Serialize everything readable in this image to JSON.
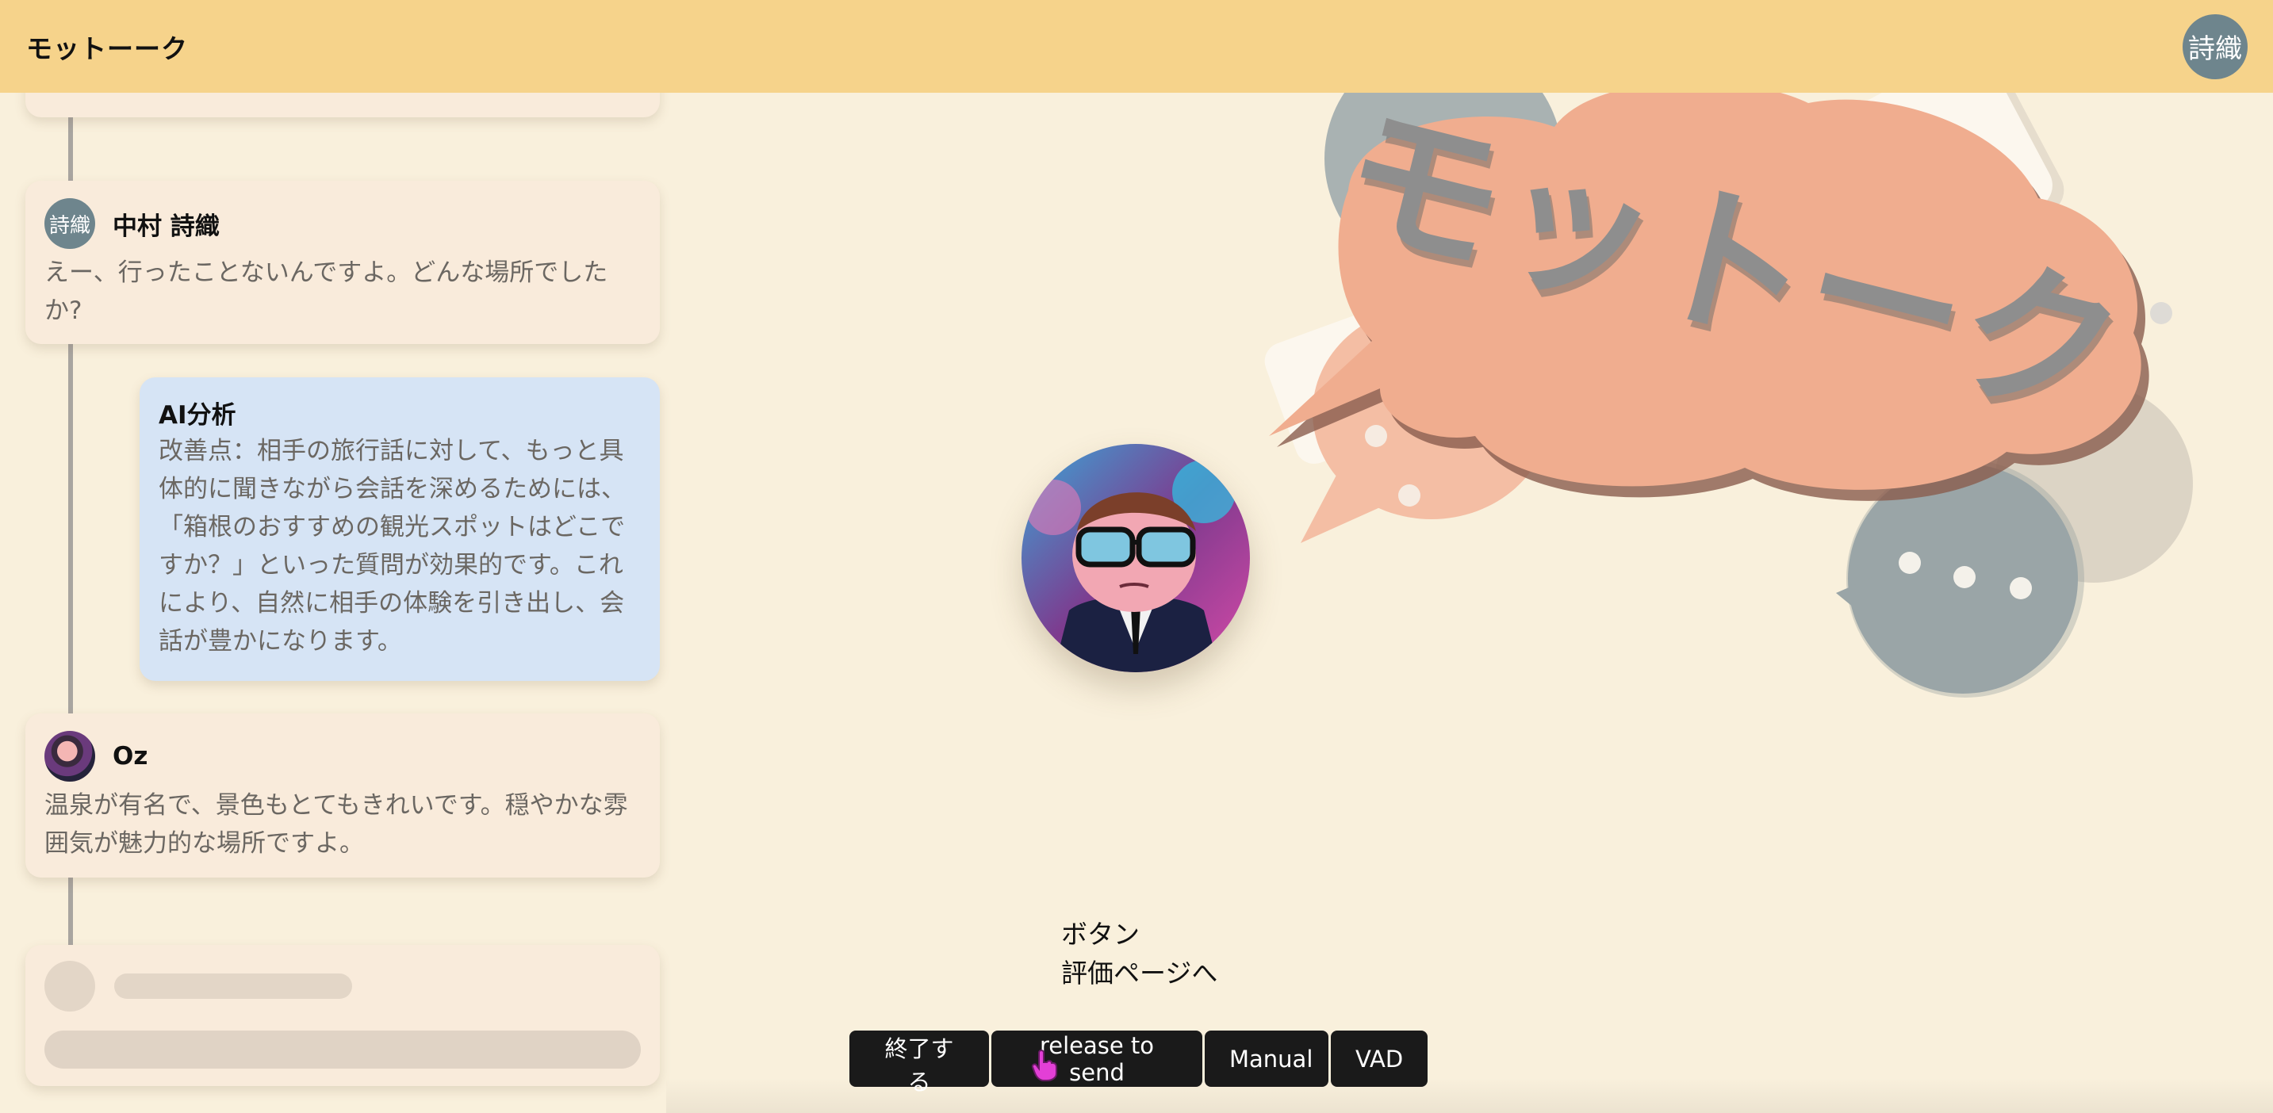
{
  "header": {
    "app_title": "モットーーク",
    "user_avatar_text": "詩織"
  },
  "chat": {
    "messages": [
      {
        "kind": "user",
        "avatar_text": "詩織",
        "name": "中村 詩織",
        "text": "えー、行ったことないんですよ。どんな場所でしたか?"
      },
      {
        "kind": "analysis",
        "name": "AI分析",
        "text": "改善点：相手の旅行話に対して、もっと具体的に聞きながら会話を深めるためには、「箱根のおすすめの観光スポットはどこですか？」といった質問が効果的です。これにより、自然に相手の体験を引き出し、会話が豊かになります。"
      },
      {
        "kind": "bot",
        "name": "Oz",
        "text": "温泉が有名で、景色もとてもきれいです。穏やかな雰囲気が魅力的な場所ですよ。"
      }
    ]
  },
  "logo": {
    "text": "モットーク"
  },
  "center": {
    "caption_line1": "ボタン",
    "caption_line2": "評価ページへ"
  },
  "controls": {
    "end_label": "終了する",
    "release_label": "release to send",
    "manual_label": "Manual",
    "vad_label": "VAD"
  },
  "colors": {
    "header": "#f6d38b",
    "background": "#f9f0dc",
    "card": "#f9ebdb",
    "analysis_card": "#d6e4f5",
    "button": "#1a1a1a",
    "logo_bubble": "#f0ad8f",
    "logo_text": "#8e8e8e"
  }
}
